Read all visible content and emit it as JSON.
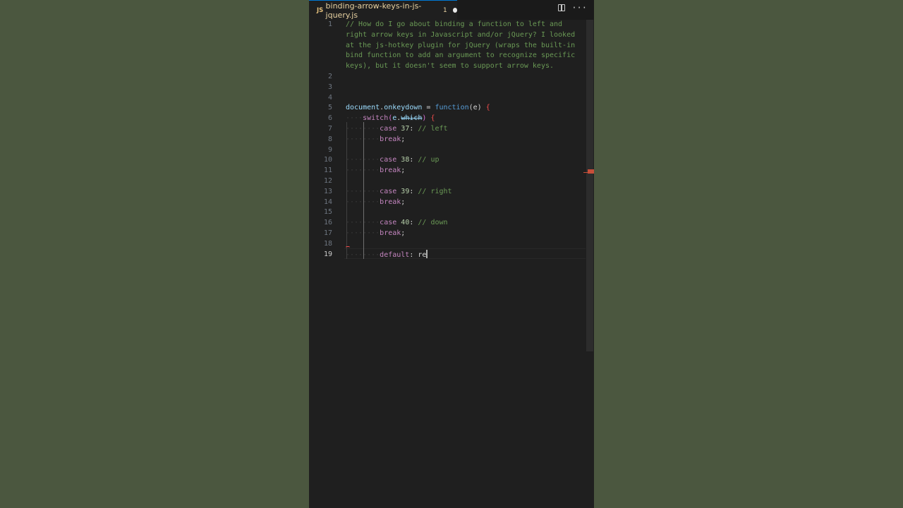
{
  "tab": {
    "file_icon": "JS",
    "title": "binding-arrow-keys-in-js-jquery.js",
    "badge": "1",
    "modified": true
  },
  "actions": {
    "split_icon": "split-editor-icon",
    "more_icon": "more-actions-icon",
    "more_glyph": "···"
  },
  "gutter": {
    "lines": [
      "1",
      "2",
      "3",
      "4",
      "5",
      "6",
      "7",
      "8",
      "9",
      "10",
      "11",
      "12",
      "13",
      "14",
      "15",
      "16",
      "17",
      "18",
      "19"
    ],
    "active_line": "19"
  },
  "code": {
    "comment_lines": [
      "// How do I go about binding a function to left and",
      "right arrow keys in Javascript and/or jQuery? I looked",
      "at the js-hotkey plugin for jQuery (wraps the built-in",
      "bind function to add an argument to recognize specific",
      "keys), but it doesn't seem to support arrow keys."
    ],
    "l5": {
      "obj": "document",
      "dot": ".",
      "prop": "onkeydown",
      "eq": " = ",
      "fn": "function",
      "param": "(e) ",
      "brace": "{"
    },
    "l6": {
      "indent": "····",
      "kw": "switch",
      "open": "(",
      "obj": "e",
      "dot": ".",
      "prop": "which",
      "close": ") ",
      "brace": "{"
    },
    "cases": [
      {
        "indent": "········",
        "kw": "case",
        "num": "37",
        "colon": ": ",
        "comment": "// left"
      },
      {
        "indent": "········",
        "kw": "case",
        "num": "38",
        "colon": ": ",
        "comment": "// up"
      },
      {
        "indent": "········",
        "kw": "case",
        "num": "39",
        "colon": ": ",
        "comment": "// right"
      },
      {
        "indent": "········",
        "kw": "case",
        "num": "40",
        "colon": ": ",
        "comment": "// down"
      }
    ],
    "break_line": {
      "indent": "········",
      "kw": "break",
      "semi": ";"
    },
    "l19": {
      "indent": "········",
      "kw": "default",
      "colon": ": ",
      "typed": "re"
    }
  },
  "colors": {
    "background": "#4b573f",
    "editor": "#1f1f1f",
    "comment": "#6a9955",
    "keyword": "#c586c0",
    "variable": "#9cdcfe",
    "function": "#dcdcaa",
    "number": "#b5cea8",
    "error": "#f14c4c"
  }
}
